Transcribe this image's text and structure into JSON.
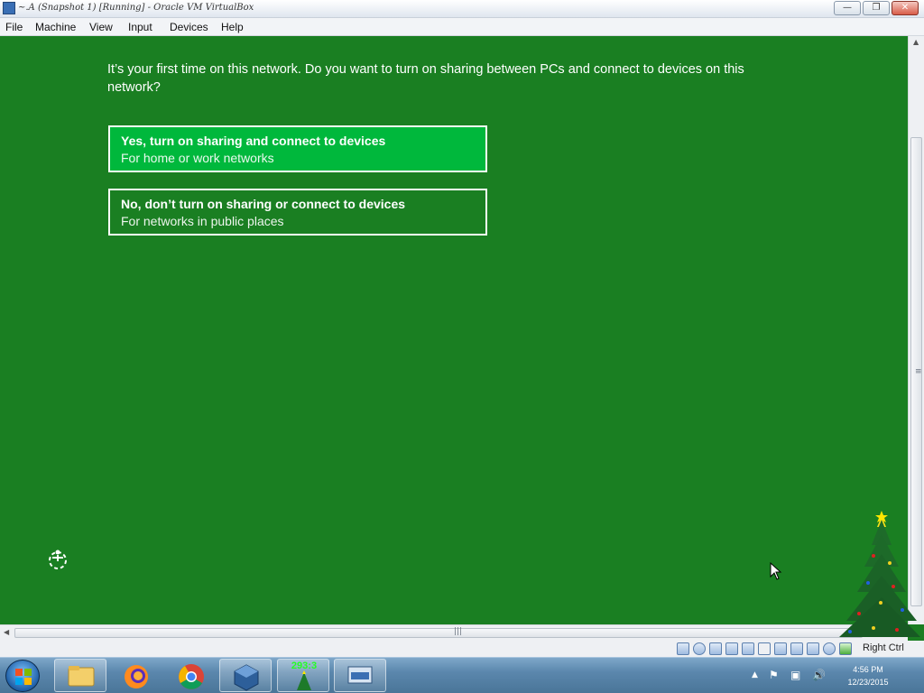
{
  "window": {
    "title": "~.A (Snapshot 1) [Running] - Oracle VM VirtualBox",
    "minimize_label": "—",
    "restore_label": "❐",
    "close_label": "✕"
  },
  "menu": {
    "file": "File",
    "machine": "Machine",
    "view": "View",
    "input": "Input",
    "devices": "Devices",
    "help": "Help"
  },
  "network_prompt": {
    "question": "It’s your first time on this network. Do you want to turn on sharing between PCs and connect to devices on this network?",
    "options": [
      {
        "title": "Yes, turn on sharing and connect to devices",
        "subtitle": "For home or work networks"
      },
      {
        "title": "No, don’t turn on sharing or connect to devices",
        "subtitle": "For networks in public places"
      }
    ]
  },
  "statusbar": {
    "host_key": "Right Ctrl",
    "icons": [
      "hard-disk-icon",
      "optical-drive-icon",
      "audio-icon",
      "network-icon",
      "usb-icon",
      "shared-folders-icon",
      "display-icon",
      "video-capture-icon",
      "cpu-icon",
      "mouse-integration-icon",
      "host-key-icon"
    ]
  },
  "taskbar": {
    "apps": [
      "explorer",
      "firefox",
      "chrome",
      "virtualbox",
      "tree-counter",
      "keyboard-app"
    ],
    "counter_label": "293:3",
    "clock_time": "4:56 PM",
    "clock_date": "12/23/2015"
  },
  "colors": {
    "background": "#1a7f22",
    "selected_option": "#00b83c",
    "text": "#ffffff"
  }
}
